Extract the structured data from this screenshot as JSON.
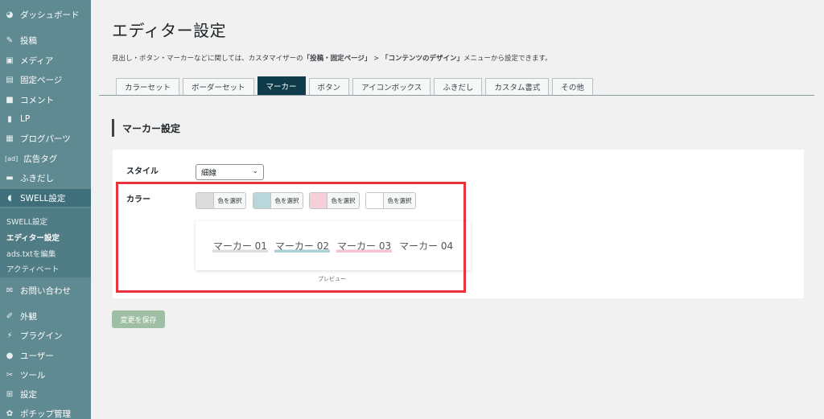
{
  "sidebar": {
    "items": [
      {
        "label": "ダッシュボード",
        "icon": "dashboard-icon"
      },
      {
        "label": "投稿",
        "icon": "pin-icon"
      },
      {
        "label": "メディア",
        "icon": "media-icon"
      },
      {
        "label": "固定ページ",
        "icon": "page-icon"
      },
      {
        "label": "コメント",
        "icon": "comment-icon"
      },
      {
        "label": "LP",
        "icon": "lp-icon"
      },
      {
        "label": "ブログパーツ",
        "icon": "parts-icon"
      },
      {
        "label": "広告タグ",
        "icon": "ad-icon",
        "icon_text": "[ad]"
      },
      {
        "label": "ふきだし",
        "icon": "balloon-icon"
      },
      {
        "label": "SWELL設定",
        "icon": "swell-icon"
      },
      {
        "label": "お問い合わせ",
        "icon": "mail-icon"
      },
      {
        "label": "外観",
        "icon": "brush-icon"
      },
      {
        "label": "プラグイン",
        "icon": "plugin-icon"
      },
      {
        "label": "ユーザー",
        "icon": "user-icon"
      },
      {
        "label": "ツール",
        "icon": "wrench-icon"
      },
      {
        "label": "設定",
        "icon": "settings-icon"
      },
      {
        "label": "ポチップ管理",
        "icon": "paw-icon"
      }
    ],
    "submenu": [
      "SWELL設定",
      "エディター設定",
      "ads.txtを編集",
      "アクティベート"
    ]
  },
  "page": {
    "title": "エディター設定",
    "description_prefix": "見出し・ボタン・マーカーなどに関しては、カスタマイザーの",
    "description_b1": "「投稿・固定ページ」",
    "description_sep": " > ",
    "description_b2": "「コンテンツのデザイン」",
    "description_suffix": "メニューから設定できます。"
  },
  "tabs": [
    "カラーセット",
    "ボーダーセット",
    "マーカー",
    "ボタン",
    "アイコンボックス",
    "ふきだし",
    "カスタム書式",
    "その他"
  ],
  "active_tab_index": 2,
  "section": {
    "heading": "マーカー設定",
    "style_label": "スタイル",
    "style_value": "細線",
    "color_label": "カラー",
    "color_buttons": [
      {
        "label": "色を選択",
        "color": "#dcdcdc"
      },
      {
        "label": "色を選択",
        "color": "#b9d6da"
      },
      {
        "label": "色を選択",
        "color": "#f7cfd8"
      },
      {
        "label": "色を選択",
        "color": "#ffffff"
      }
    ],
    "markers": [
      {
        "label": "マーカー 01",
        "color": "#dcdcdc"
      },
      {
        "label": "マーカー 02",
        "color": "#a9d0d5"
      },
      {
        "label": "マーカー 03",
        "color": "#f5c3d0"
      },
      {
        "label": "マーカー 04",
        "color": "#ffffff"
      }
    ],
    "preview_label": "プレビュー"
  },
  "save_button": "変更を保存",
  "colors": {
    "sidebar": "#5f8a92",
    "active_tab": "#0f3b4a",
    "highlight": "#e8333a",
    "save": "#9fbfa4"
  }
}
